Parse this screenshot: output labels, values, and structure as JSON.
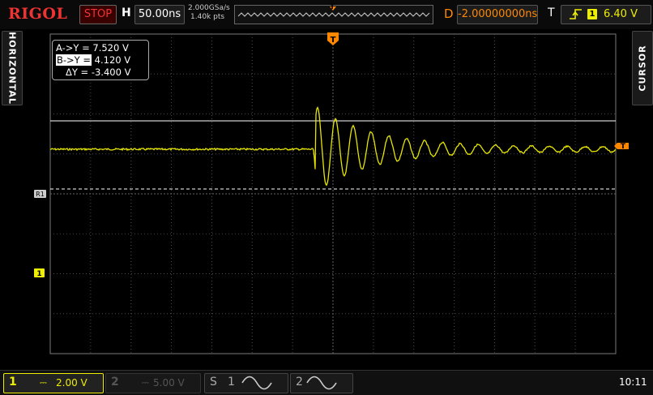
{
  "header": {
    "logo": "RIGOL",
    "run_state": "STOP",
    "horizontal_label": "H",
    "timebase": "50.00ns",
    "sample_rate": "2.000GSa/s",
    "memory_depth": "1.40k pts",
    "delay_label": "D",
    "delay_value": "-2.00000000ns",
    "trigger_label": "T",
    "trigger_channel": "1",
    "trigger_level": "6.40 V"
  },
  "side_tabs": {
    "left": "HORIZONTAL",
    "right": "CURSOR"
  },
  "cursor_readout": {
    "a_label": "A->Y =",
    "a_value": "7.520 V",
    "b_label": "B->Y =",
    "b_value": "4.120 V",
    "delta_label": "ΔY =",
    "delta_value": "-3.400 V"
  },
  "markers": {
    "trigger_pos": "T",
    "ref_marker": "R1",
    "ch1_marker": "1"
  },
  "bottom": {
    "ch1_num": "1",
    "ch1_scale": "2.00 V",
    "ch2_num": "2",
    "ch2_scale": "5.00 V",
    "math_s": "S",
    "math1_num": "1",
    "math2_num": "2",
    "clock": "10:11"
  },
  "colors": {
    "ch1": "#eeee00",
    "trigger": "#ff8800",
    "cursor": "#ffffff",
    "stop": "#ee3333"
  }
}
